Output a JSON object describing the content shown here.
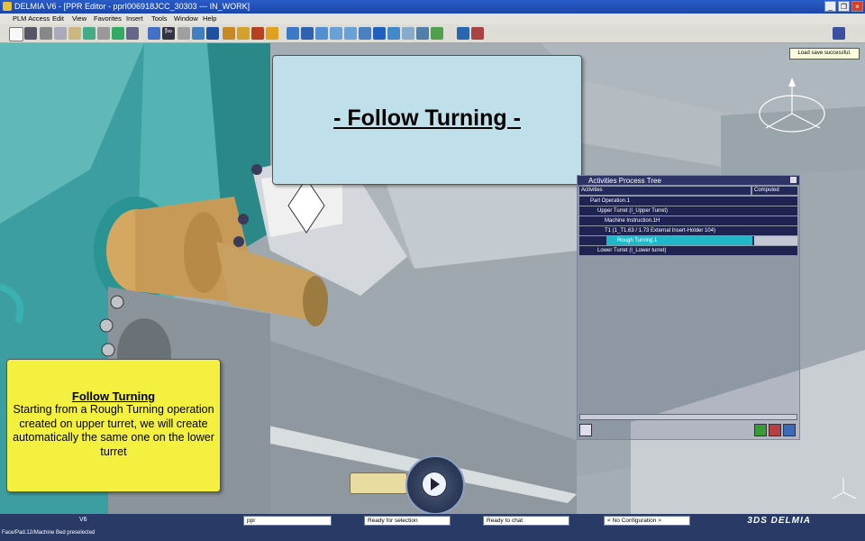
{
  "window": {
    "title": "DELMIA V6 - [PPR Editor - pprI006918JCC_30303 --- IN_WORK]"
  },
  "menu": {
    "items": [
      "PLM Access",
      "Edit",
      "View",
      "Favorites",
      "Insert",
      "Tools",
      "Window",
      "Help"
    ]
  },
  "tooltip": {
    "text": "Load save successful."
  },
  "banner": {
    "title": "- Follow Turning -"
  },
  "note": {
    "heading": "Follow Turning",
    "body": "Starting from a Rough Turning operation created on upper turret, we will create automatically the same one on the lower turret"
  },
  "tree": {
    "title": "Activities Process Tree",
    "col_activities": "Activities",
    "col_computed": "Computed",
    "rows": [
      "Part Operation.1",
      "Upper Turret (I_Upper Turret)",
      "Machine Instruction.1H",
      "T1 (1_T1.63 / 1.73 External Insert-Holder 104)",
      "Rough Turning.1",
      "Lower Turret (I_Lower turret)"
    ]
  },
  "status": {
    "version": "V6",
    "field1": "ppr",
    "field2": "Ready for selection",
    "field3": "Ready to chat",
    "field4": "< No Configuration >",
    "bottom_text": "Face/Pad.12/Machine Bed preselected",
    "brand": "DELMIA",
    "brand_prefix": "3DS"
  },
  "colors": {
    "selection": "#20b8c8",
    "note_bg": "#f4f040",
    "banner_bg": "#bfe0ea"
  }
}
